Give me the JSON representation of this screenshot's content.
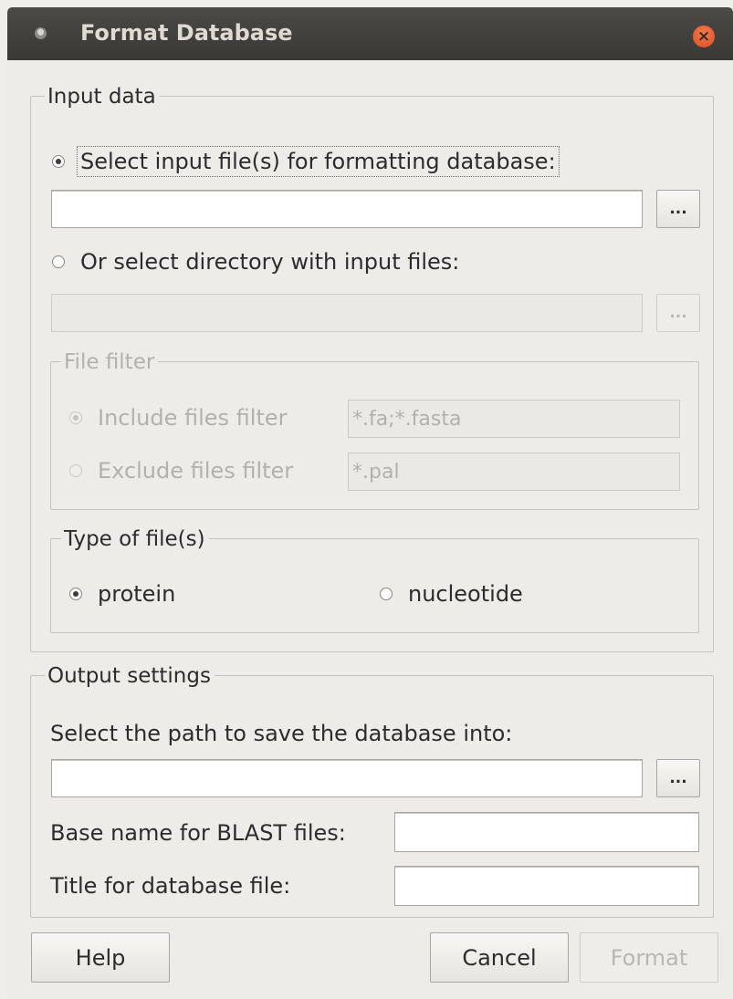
{
  "window": {
    "title": "Format Database",
    "close_glyph": "×",
    "app_icon": "window-menu-icon",
    "close_icon": "close-icon"
  },
  "input_group": {
    "title": "Input data",
    "select_files_label": "Select input file(s) for formatting database:",
    "select_files_checked": true,
    "input_files_value": "",
    "browse_label": "...",
    "select_dir_label": "Or select directory with input files:",
    "select_dir_checked": false,
    "input_dir_value": "",
    "browse_dir_label": "..."
  },
  "file_filter": {
    "title": "File filter",
    "include_label": "Include files filter",
    "include_value": "*.fa;*.fasta",
    "exclude_label": "Exclude files filter",
    "exclude_value": "*.pal"
  },
  "file_type": {
    "title": "Type of file(s)",
    "protein_label": "protein",
    "nucleotide_label": "nucleotide",
    "selected": "protein"
  },
  "output_group": {
    "title": "Output settings",
    "path_label": "Select the path to save the database into:",
    "path_value": "",
    "browse_label": "...",
    "base_name_label": "Base name for BLAST files:",
    "base_name_value": "",
    "db_title_label": "Title for database file:",
    "db_title_value": ""
  },
  "buttons": {
    "help": "Help",
    "cancel": "Cancel",
    "format": "Format"
  },
  "colors": {
    "titlebar": "#3f3e3b",
    "close_button": "#e85f30",
    "window_bg": "#eeece9",
    "disabled_text": "#b3b1ad"
  }
}
